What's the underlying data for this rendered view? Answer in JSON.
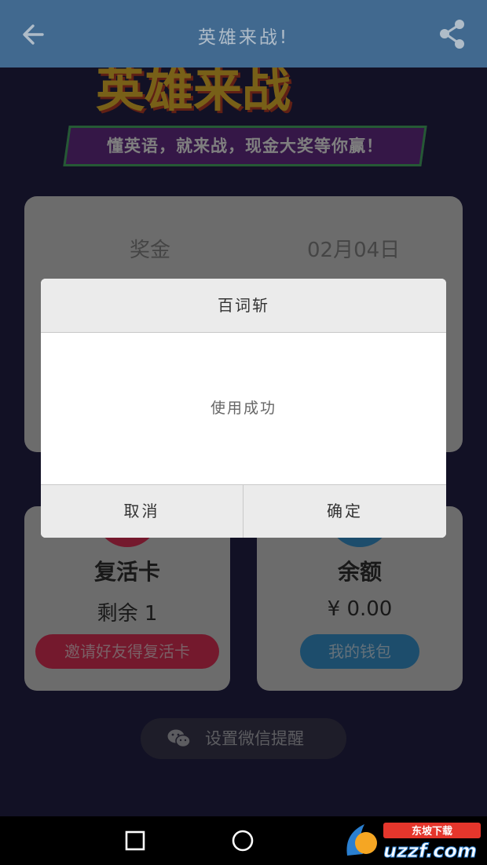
{
  "appbar": {
    "title": "英雄来战!",
    "back_icon": "arrow-left-icon",
    "share_icon": "share-icon"
  },
  "banner": {
    "headline": "英雄来战",
    "slogan": "懂英语，就来战，现金大奖等你赢！"
  },
  "prize_card": {
    "label": "奖金",
    "date": "02月04日"
  },
  "revive_card": {
    "title": "复活卡",
    "remaining": "剩余 1",
    "button": "邀请好友得复活卡"
  },
  "balance_card": {
    "title": "余额",
    "amount": "¥ 0.00",
    "button": "我的钱包"
  },
  "reminder": {
    "label": "设置微信提醒",
    "icon": "wechat-icon"
  },
  "dialog": {
    "title": "百词斩",
    "message": "使用成功",
    "cancel": "取消",
    "confirm": "确定"
  },
  "colors": {
    "appbar": "#4a78a3",
    "pink": "#e8335a",
    "blue": "#3a9ad9"
  },
  "watermark": {
    "brand": "uzzf.com",
    "tag": "东坡下载"
  }
}
